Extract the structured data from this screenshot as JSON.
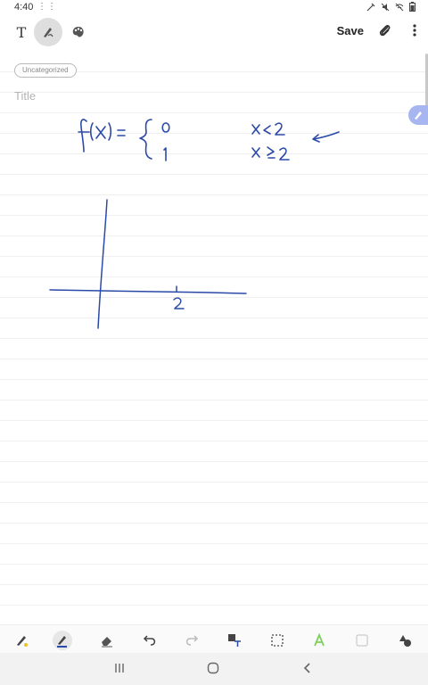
{
  "status": {
    "time": "4:40",
    "dots": "⋮⋮"
  },
  "toolbar": {
    "text_tool": "T",
    "save_label": "Save"
  },
  "note": {
    "category": "Uncategorized",
    "title_placeholder": "Title"
  },
  "handwriting": {
    "function_def": "f(x) = { 0  x<2 ; 1  x≥2",
    "axis_tick_label": "2"
  },
  "colors": {
    "ink": "#2b4aa8",
    "accent": "#a7b6f0"
  }
}
